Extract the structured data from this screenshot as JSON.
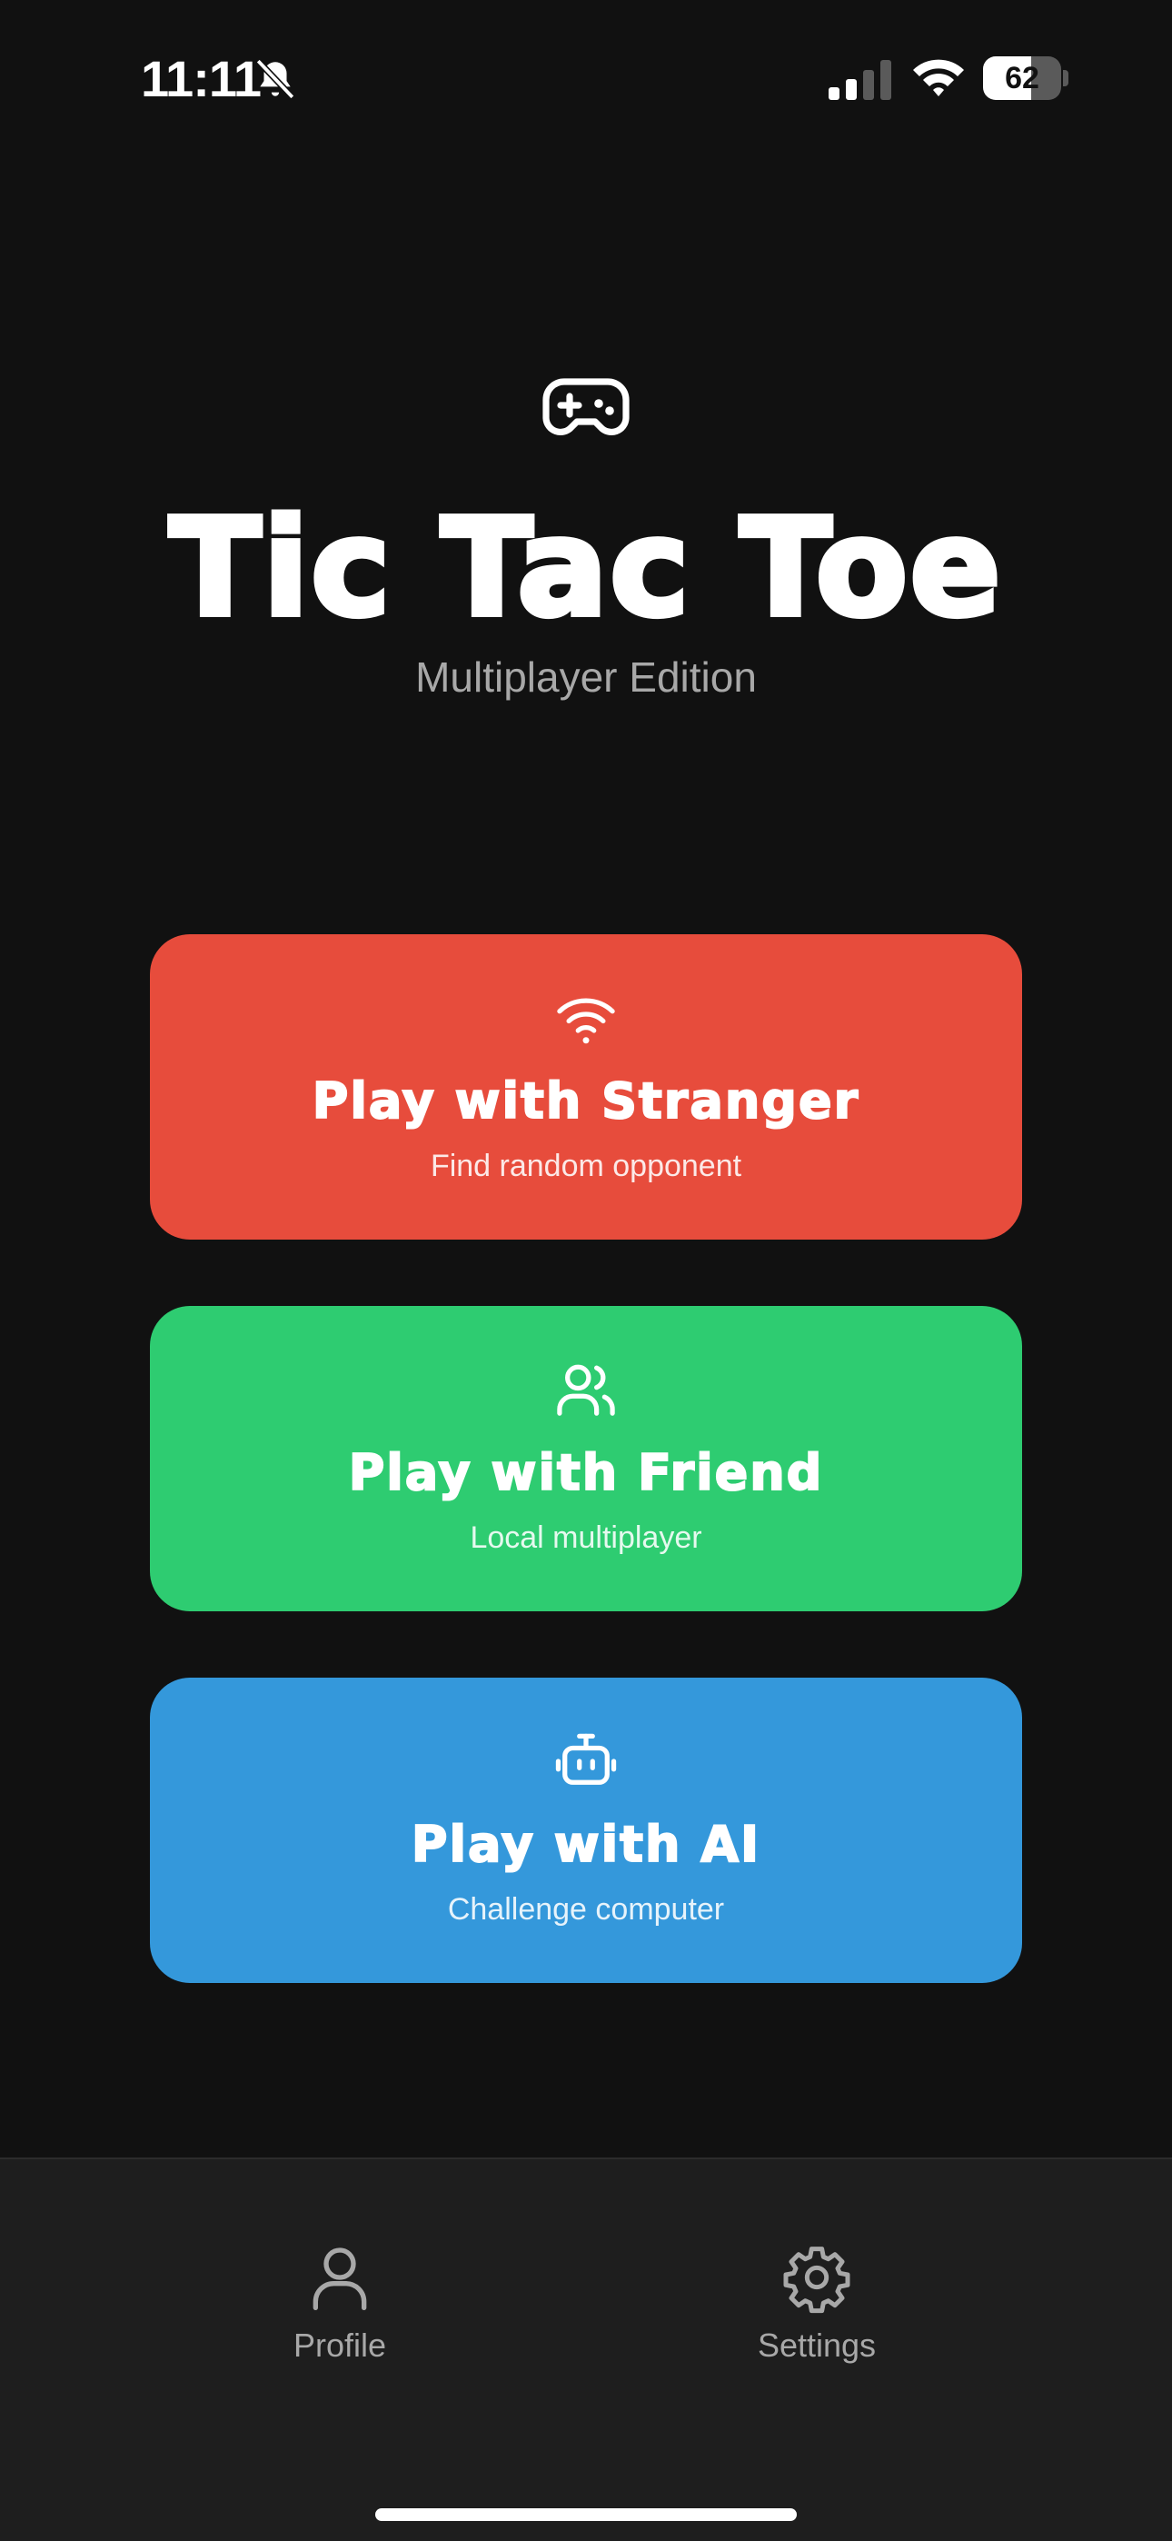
{
  "status_bar": {
    "time": "11:11",
    "battery_level": "62",
    "battery_fraction": 0.62,
    "icons": [
      "bell-slash-icon",
      "cellular-signal-icon",
      "wifi-icon",
      "battery-icon"
    ]
  },
  "header": {
    "icon": "gamepad-icon",
    "title": "Tic Tac Toe",
    "subtitle": "Multiplayer Edition"
  },
  "modes": [
    {
      "icon": "wifi-icon",
      "label": "Play with Stranger",
      "sublabel": "Find random opponent",
      "color": "#e74c3c"
    },
    {
      "icon": "users-icon",
      "label": "Play with Friend",
      "sublabel": "Local multiplayer",
      "color": "#2ecc71"
    },
    {
      "icon": "robot-icon",
      "label": "Play with AI",
      "sublabel": "Challenge computer",
      "color": "#3498db"
    }
  ],
  "tab_bar": {
    "items": [
      {
        "icon": "user-icon",
        "label": "Profile"
      },
      {
        "icon": "gear-icon",
        "label": "Settings"
      }
    ]
  },
  "colors": {
    "background": "#111111",
    "tab_bar": "#1e1e1e",
    "muted_text": "#a8a8a8"
  }
}
